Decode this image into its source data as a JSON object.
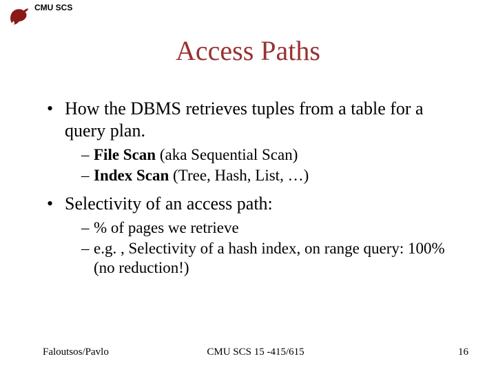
{
  "header": {
    "org": "CMU SCS"
  },
  "title": "Access Paths",
  "bullets": {
    "b1": "How the DBMS retrieves tuples from a table for a query plan.",
    "b1_sub1_bold": "File Scan",
    "b1_sub1_rest": " (aka Sequential Scan)",
    "b1_sub2_bold": "Index Scan",
    "b1_sub2_rest": " (Tree, Hash, List, …)",
    "b2": "Selectivity of an access path:",
    "b2_sub1": "% of pages we retrieve",
    "b2_sub2": "e.g. , Selectivity of a hash index, on range query: 100% (no reduction!)"
  },
  "footer": {
    "left": "Faloutsos/Pavlo",
    "center": "CMU SCS 15 -415/615",
    "page": "16"
  }
}
